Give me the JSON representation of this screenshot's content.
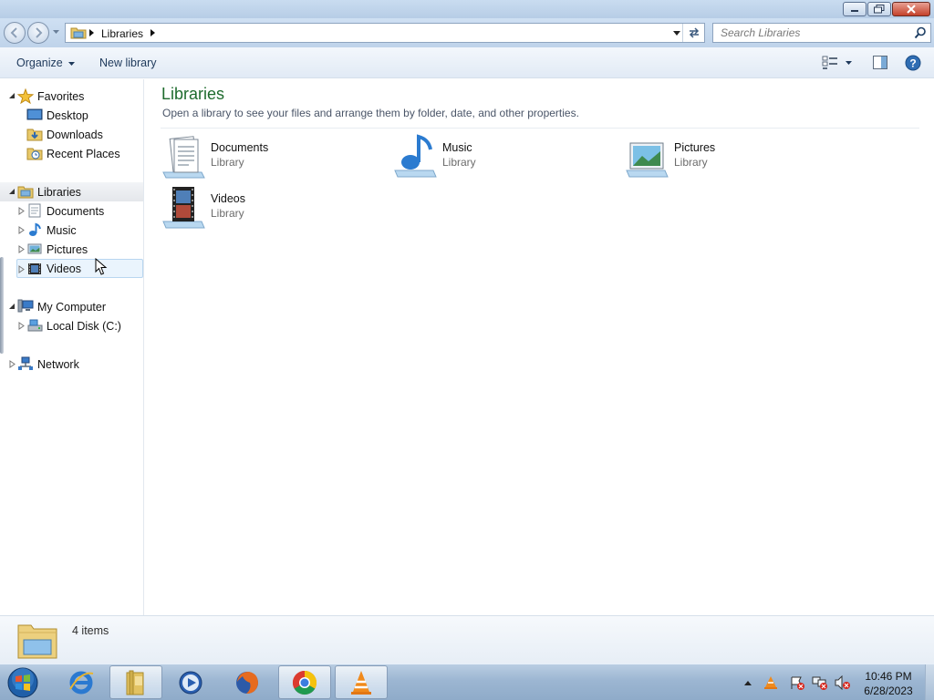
{
  "window": {
    "controls": [
      "minimize",
      "restore",
      "close"
    ]
  },
  "address_bar": {
    "crumb": "Libraries",
    "search_placeholder": "Search Libraries"
  },
  "command_bar": {
    "organize_label": "Organize",
    "new_library_label": "New library"
  },
  "nav_pane": {
    "favorites": {
      "label": "Favorites",
      "expanded": true,
      "items": [
        {
          "label": "Desktop",
          "icon": "desktop-icon"
        },
        {
          "label": "Downloads",
          "icon": "downloads-icon"
        },
        {
          "label": "Recent Places",
          "icon": "recent-places-icon"
        }
      ]
    },
    "libraries": {
      "label": "Libraries",
      "expanded": true,
      "selected": true,
      "items": [
        {
          "label": "Documents",
          "icon": "documents-icon"
        },
        {
          "label": "Music",
          "icon": "music-icon"
        },
        {
          "label": "Pictures",
          "icon": "pictures-icon"
        },
        {
          "label": "Videos",
          "icon": "videos-icon",
          "hovered": true
        }
      ]
    },
    "computer": {
      "label": "My Computer",
      "expanded": true,
      "items": [
        {
          "label": "Local Disk (C:)",
          "icon": "local-disk-icon"
        }
      ]
    },
    "network": {
      "label": "Network",
      "expanded": false
    }
  },
  "content": {
    "title": "Libraries",
    "subtitle": "Open a library to see your files and arrange them by folder, date, and other properties.",
    "tiles": [
      {
        "name": "Documents",
        "type": "Library",
        "icon": "documents-library-icon"
      },
      {
        "name": "Music",
        "type": "Library",
        "icon": "music-library-icon"
      },
      {
        "name": "Pictures",
        "type": "Library",
        "icon": "pictures-library-icon"
      },
      {
        "name": "Videos",
        "type": "Library",
        "icon": "videos-library-icon"
      }
    ]
  },
  "details": {
    "count_text": "4 items"
  },
  "taskbar": {
    "pinned": [
      "start-orb",
      "internet-explorer",
      "windows-explorer",
      "windows-media-player",
      "firefox",
      "chrome",
      "vlc"
    ],
    "active": "windows-explorer",
    "tray_icons": [
      "show-hidden-icons",
      "vlc-tray",
      "action-center-alert",
      "network-alert",
      "volume-muted"
    ],
    "time": "10:46 PM",
    "date": "6/28/2023"
  },
  "colors": {
    "title_green": "#1e6b2d",
    "link_blue": "#1e395b",
    "selection": "#eaf4fd"
  }
}
